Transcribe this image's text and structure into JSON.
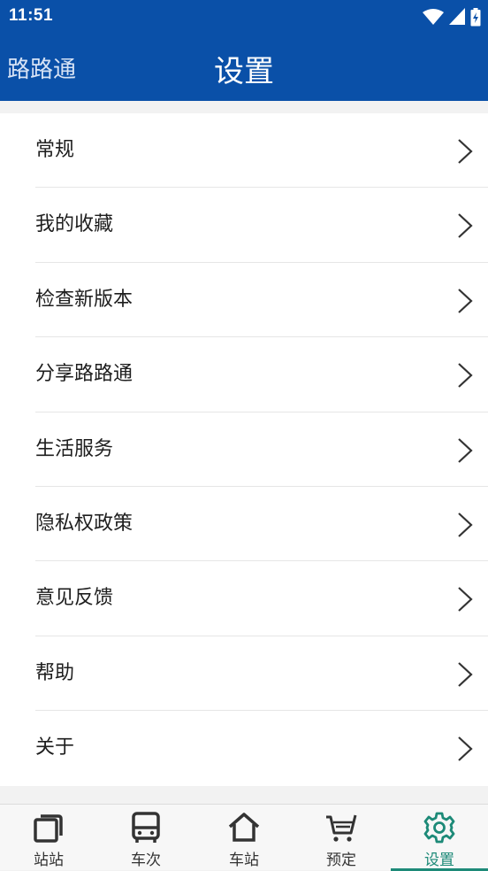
{
  "status_bar": {
    "time": "11:51"
  },
  "header": {
    "brand": "路路通",
    "title": "设置"
  },
  "menu": {
    "items": [
      {
        "label": "常规"
      },
      {
        "label": "我的收藏"
      },
      {
        "label": "检查新版本"
      },
      {
        "label": "分享路路通"
      },
      {
        "label": "生活服务"
      },
      {
        "label": "隐私权政策"
      },
      {
        "label": "意见反馈"
      },
      {
        "label": "帮助"
      },
      {
        "label": "关于"
      }
    ]
  },
  "tabbar": {
    "tabs": [
      {
        "label": "站站",
        "icon": "station-to-station-icon"
      },
      {
        "label": "车次",
        "icon": "bus-icon"
      },
      {
        "label": "车站",
        "icon": "home-icon"
      },
      {
        "label": "预定",
        "icon": "cart-icon"
      },
      {
        "label": "设置",
        "icon": "gear-icon"
      }
    ],
    "active_index": 4
  },
  "colors": {
    "header_bg": "#0a50a8",
    "active_tab": "#1d8a78"
  }
}
